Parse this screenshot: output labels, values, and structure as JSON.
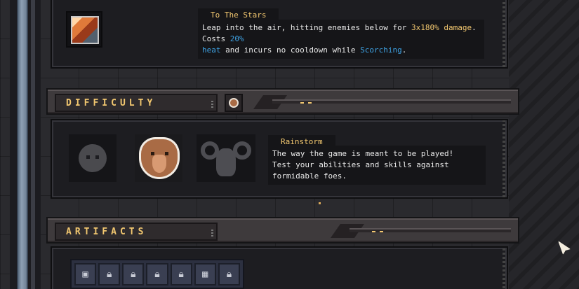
{
  "skill": {
    "icon": "leap-skill-icon",
    "title": "To The Stars",
    "desc_1": "Leap into the air, hitting enemies below for ",
    "desc_dmg": "3x180% damage",
    "desc_2": ". Costs ",
    "desc_heat_pct": "20%",
    "desc_heat_word": "heat",
    "desc_3": " and incurs no cooldown while ",
    "desc_scorching": "Scorching",
    "desc_4": "."
  },
  "difficulty": {
    "header": "DIFFICULTY",
    "selected_icon": "rainstorm-icon",
    "options": [
      {
        "name_icon": "drizzle-icon"
      },
      {
        "name_icon": "rainstorm-icon"
      },
      {
        "name_icon": "monsoon-icon"
      }
    ],
    "title": "Rainstorm",
    "desc_line_1": "The way the game is meant to be played!",
    "desc_line_2": "Test your abilities and skills against formidable foes."
  },
  "artifacts": {
    "header": "ARTIFACTS",
    "slots": [
      "frame-icon",
      "lock-icon",
      "lock-icon",
      "lock-icon",
      "lock-icon",
      "gate-icon",
      "lock-icon"
    ]
  },
  "colors": {
    "accent_yellow": "#f3c870",
    "accent_blue": "#3fa4e6",
    "panel_bg": "#1d1d21"
  }
}
